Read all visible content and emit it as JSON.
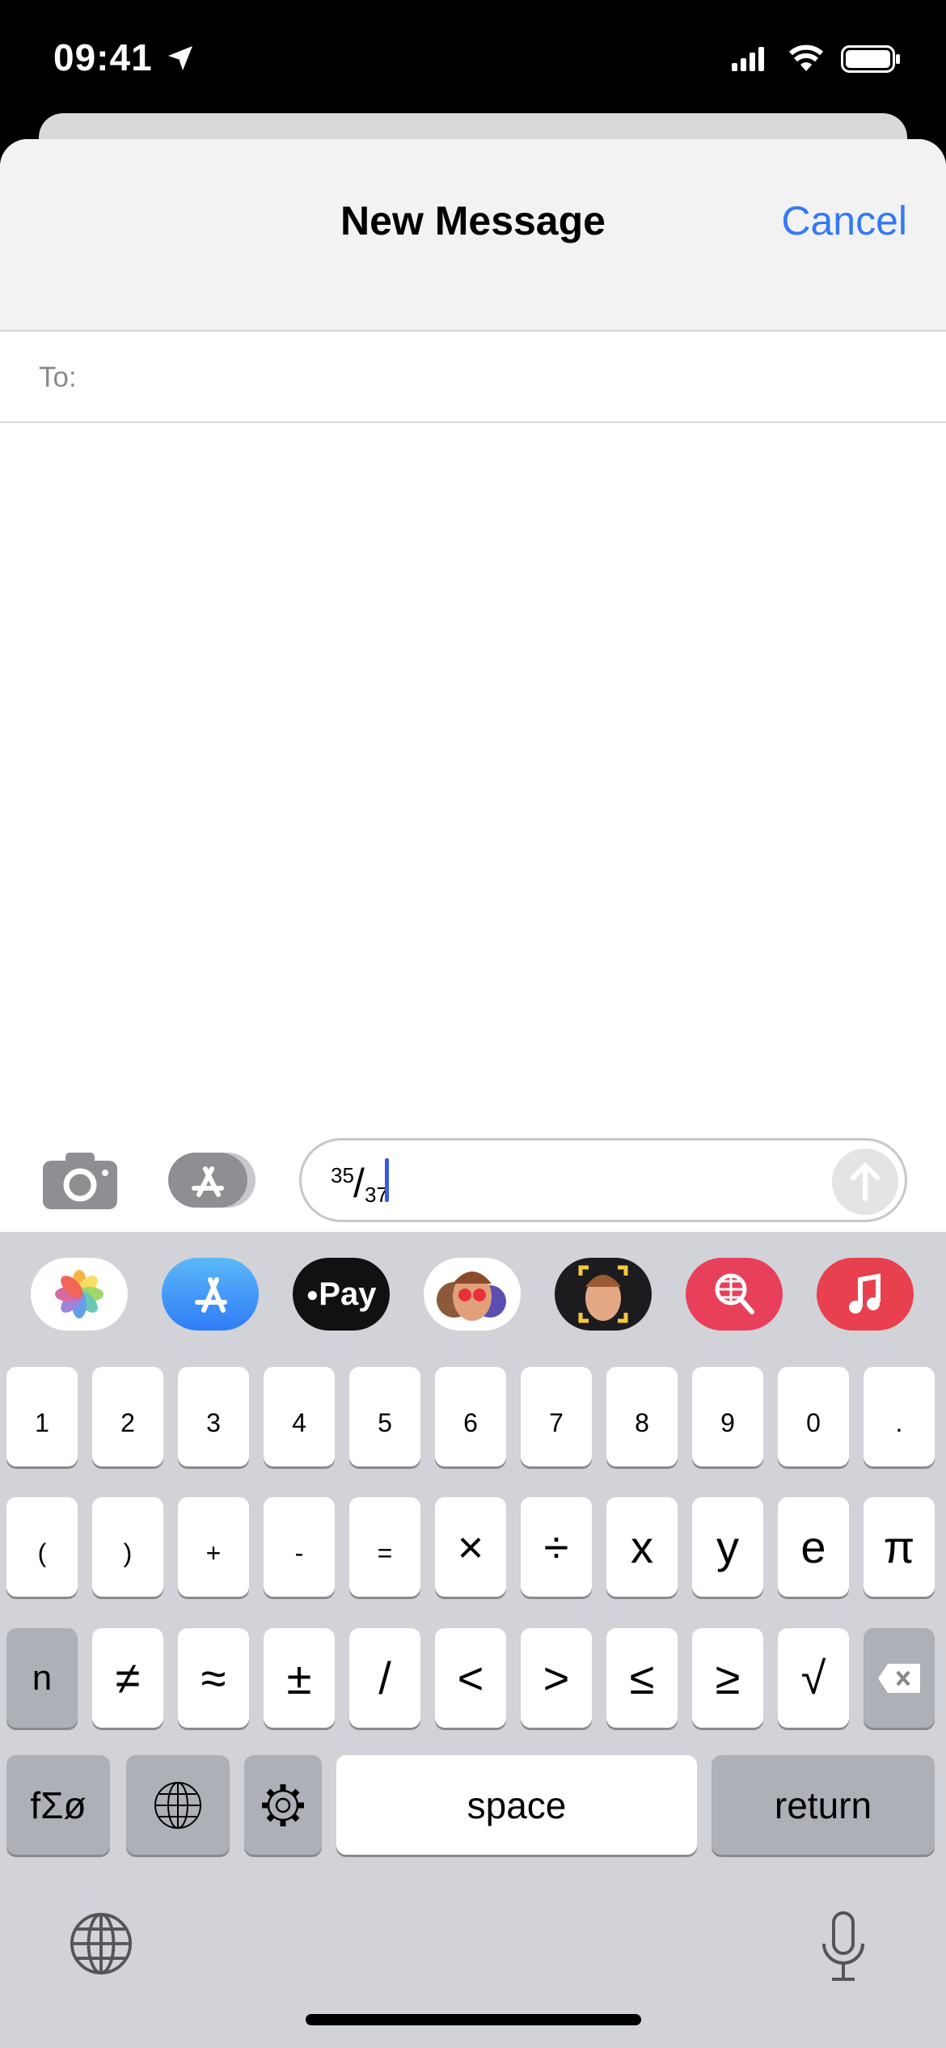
{
  "status": {
    "time": "09:41",
    "icons": [
      "location-arrow-icon",
      "cellular-signal-icon",
      "wifi-icon",
      "battery-icon"
    ]
  },
  "header": {
    "title": "New Message",
    "cancel": "Cancel"
  },
  "to": {
    "label": "To:"
  },
  "compose": {
    "numerator": "35",
    "slash": "/",
    "denominator": "37"
  },
  "app_strip": [
    "photos",
    "app-store",
    "apple-pay",
    "memoji-stickers",
    "memoji",
    "web-images-search",
    "music"
  ],
  "apple_pay_label": "Pay",
  "keyboard": {
    "row1": [
      "1",
      "2",
      "3",
      "4",
      "5",
      "6",
      "7",
      "8",
      "9",
      "0",
      "."
    ],
    "row2": [
      "(",
      ")",
      "+",
      "-",
      "=",
      "×",
      "÷",
      "x",
      "y",
      "e",
      "π"
    ],
    "row3": [
      "n",
      "≠",
      "≈",
      "±",
      "/",
      "<",
      ">",
      "≤",
      "≥",
      "√"
    ],
    "row4": {
      "symbols": "fΣø",
      "space": "space",
      "return": "return"
    }
  },
  "colors": {
    "accent": "#3478f6",
    "keyboard_bg": "#d1d3d9",
    "caret": "#3b5bdb"
  }
}
